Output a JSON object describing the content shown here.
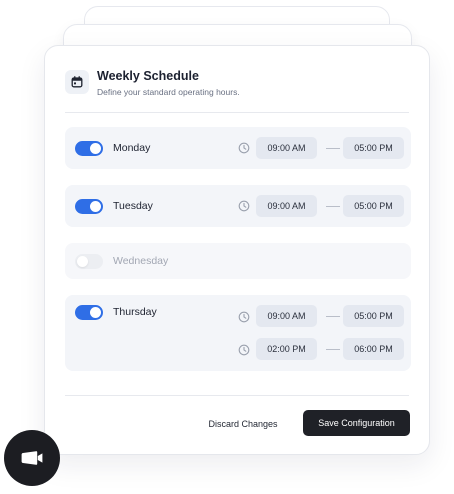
{
  "schedule": {
    "title": "Weekly Schedule",
    "subtitle": "Define your standard operating hours.",
    "icon": "calendar-icon",
    "days": [
      {
        "name": "Monday",
        "enabled": true,
        "ranges": [
          {
            "start": "09:00 AM",
            "end": "05:00 PM"
          }
        ]
      },
      {
        "name": "Tuesday",
        "enabled": true,
        "ranges": [
          {
            "start": "09:00 AM",
            "end": "05:00 PM"
          }
        ]
      },
      {
        "name": "Wednesday",
        "enabled": false,
        "ranges": []
      },
      {
        "name": "Thursday",
        "enabled": true,
        "ranges": [
          {
            "start": "09:00 AM",
            "end": "05:00 PM"
          },
          {
            "start": "02:00 PM",
            "end": "06:00 PM"
          }
        ]
      }
    ],
    "actions": {
      "discard": "Discard Changes",
      "save": "Save Configuration"
    }
  },
  "fab": {
    "icon": "video-camera-icon"
  },
  "colors": {
    "accent": "#2f6ee6",
    "primary_button": "#1f2127",
    "row_bg": "#f3f5f9",
    "pill_bg": "#e4e8f0"
  }
}
